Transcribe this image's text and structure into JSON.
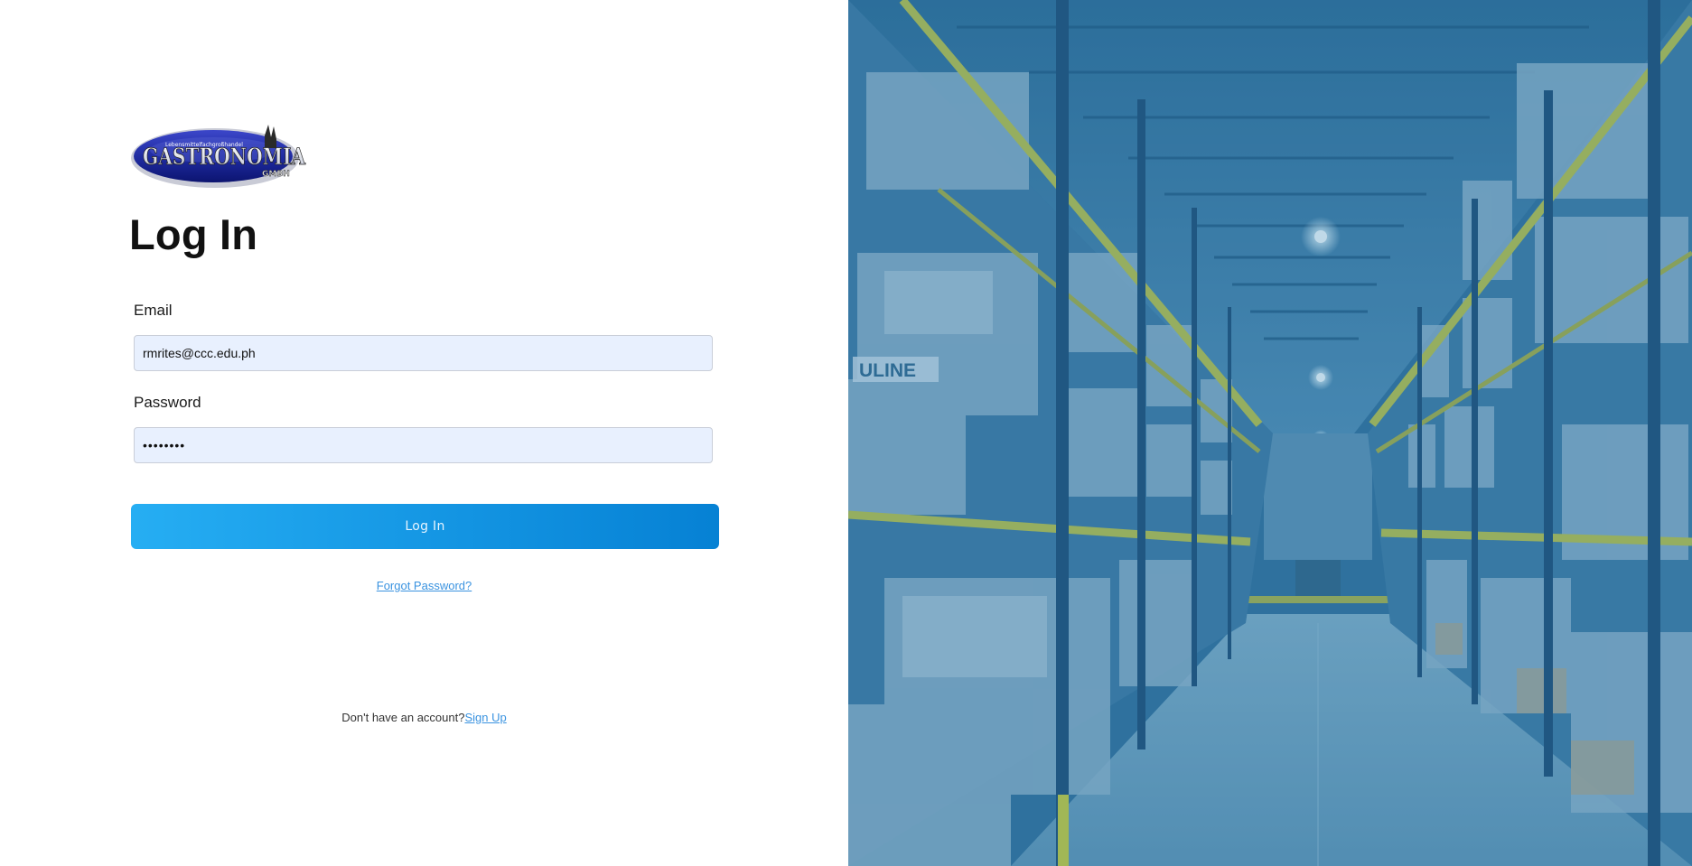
{
  "brand": {
    "logo_text": "GASTRONOMIA",
    "logo_subtext": "GMBH",
    "logo_tagline": "Lebensmittelfachgroßhandel"
  },
  "login": {
    "title": "Log In",
    "email_label": "Email",
    "email_value": "rmrites@ccc.edu.ph",
    "password_label": "Password",
    "password_value": "••••••••",
    "submit_label": "Log In",
    "forgot_label": "Forgot Password?",
    "signup_prompt": "Don't have an account?",
    "signup_link": "Sign Up"
  },
  "hero_image": {
    "subject": "warehouse aisle with pallet racks",
    "sign_text": "ULINE",
    "overlay_color": "#2d6fa3"
  },
  "colors": {
    "button_start": "#26aef3",
    "button_end": "#0681d4",
    "input_bg": "#e8f0fe",
    "link": "#3a93e0"
  }
}
